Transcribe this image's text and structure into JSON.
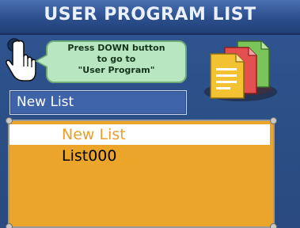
{
  "header": {
    "title": "USER PROGRAM LIST"
  },
  "hint": {
    "lines": [
      "Press DOWN button",
      "to go to",
      "\"User Program\""
    ]
  },
  "current_list": {
    "value": "New List"
  },
  "list": {
    "items": [
      {
        "label": "New List",
        "selected": true
      },
      {
        "label": "List000",
        "selected": false
      }
    ]
  },
  "icons": {
    "hand": "pointing-hand-icon",
    "documents": "program-documents-icon"
  },
  "colors": {
    "title_bar": "#2c4f8d",
    "background": "#2b4f87",
    "hint_bubble": "#b7e6c0",
    "list_background": "#eba52a",
    "selected_text": "#e8a02a"
  }
}
